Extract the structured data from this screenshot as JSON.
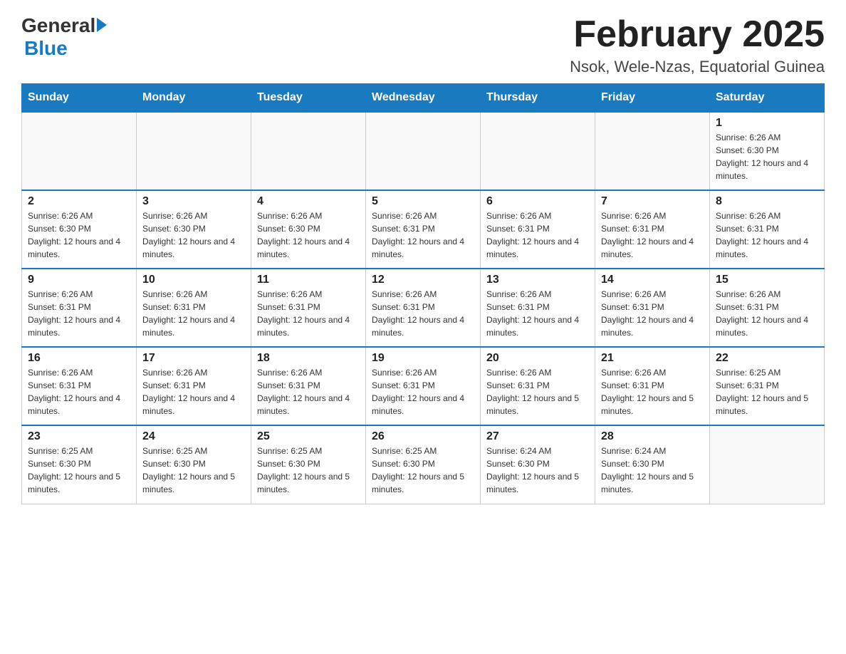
{
  "header": {
    "logo": {
      "general": "General",
      "arrow": "▶",
      "blue": "Blue"
    },
    "title": "February 2025",
    "location": "Nsok, Wele-Nzas, Equatorial Guinea"
  },
  "weekdays": [
    "Sunday",
    "Monday",
    "Tuesday",
    "Wednesday",
    "Thursday",
    "Friday",
    "Saturday"
  ],
  "weeks": [
    [
      {
        "day": "",
        "info": ""
      },
      {
        "day": "",
        "info": ""
      },
      {
        "day": "",
        "info": ""
      },
      {
        "day": "",
        "info": ""
      },
      {
        "day": "",
        "info": ""
      },
      {
        "day": "",
        "info": ""
      },
      {
        "day": "1",
        "info": "Sunrise: 6:26 AM\nSunset: 6:30 PM\nDaylight: 12 hours and 4 minutes."
      }
    ],
    [
      {
        "day": "2",
        "info": "Sunrise: 6:26 AM\nSunset: 6:30 PM\nDaylight: 12 hours and 4 minutes."
      },
      {
        "day": "3",
        "info": "Sunrise: 6:26 AM\nSunset: 6:30 PM\nDaylight: 12 hours and 4 minutes."
      },
      {
        "day": "4",
        "info": "Sunrise: 6:26 AM\nSunset: 6:30 PM\nDaylight: 12 hours and 4 minutes."
      },
      {
        "day": "5",
        "info": "Sunrise: 6:26 AM\nSunset: 6:31 PM\nDaylight: 12 hours and 4 minutes."
      },
      {
        "day": "6",
        "info": "Sunrise: 6:26 AM\nSunset: 6:31 PM\nDaylight: 12 hours and 4 minutes."
      },
      {
        "day": "7",
        "info": "Sunrise: 6:26 AM\nSunset: 6:31 PM\nDaylight: 12 hours and 4 minutes."
      },
      {
        "day": "8",
        "info": "Sunrise: 6:26 AM\nSunset: 6:31 PM\nDaylight: 12 hours and 4 minutes."
      }
    ],
    [
      {
        "day": "9",
        "info": "Sunrise: 6:26 AM\nSunset: 6:31 PM\nDaylight: 12 hours and 4 minutes."
      },
      {
        "day": "10",
        "info": "Sunrise: 6:26 AM\nSunset: 6:31 PM\nDaylight: 12 hours and 4 minutes."
      },
      {
        "day": "11",
        "info": "Sunrise: 6:26 AM\nSunset: 6:31 PM\nDaylight: 12 hours and 4 minutes."
      },
      {
        "day": "12",
        "info": "Sunrise: 6:26 AM\nSunset: 6:31 PM\nDaylight: 12 hours and 4 minutes."
      },
      {
        "day": "13",
        "info": "Sunrise: 6:26 AM\nSunset: 6:31 PM\nDaylight: 12 hours and 4 minutes."
      },
      {
        "day": "14",
        "info": "Sunrise: 6:26 AM\nSunset: 6:31 PM\nDaylight: 12 hours and 4 minutes."
      },
      {
        "day": "15",
        "info": "Sunrise: 6:26 AM\nSunset: 6:31 PM\nDaylight: 12 hours and 4 minutes."
      }
    ],
    [
      {
        "day": "16",
        "info": "Sunrise: 6:26 AM\nSunset: 6:31 PM\nDaylight: 12 hours and 4 minutes."
      },
      {
        "day": "17",
        "info": "Sunrise: 6:26 AM\nSunset: 6:31 PM\nDaylight: 12 hours and 4 minutes."
      },
      {
        "day": "18",
        "info": "Sunrise: 6:26 AM\nSunset: 6:31 PM\nDaylight: 12 hours and 4 minutes."
      },
      {
        "day": "19",
        "info": "Sunrise: 6:26 AM\nSunset: 6:31 PM\nDaylight: 12 hours and 4 minutes."
      },
      {
        "day": "20",
        "info": "Sunrise: 6:26 AM\nSunset: 6:31 PM\nDaylight: 12 hours and 5 minutes."
      },
      {
        "day": "21",
        "info": "Sunrise: 6:26 AM\nSunset: 6:31 PM\nDaylight: 12 hours and 5 minutes."
      },
      {
        "day": "22",
        "info": "Sunrise: 6:25 AM\nSunset: 6:31 PM\nDaylight: 12 hours and 5 minutes."
      }
    ],
    [
      {
        "day": "23",
        "info": "Sunrise: 6:25 AM\nSunset: 6:30 PM\nDaylight: 12 hours and 5 minutes."
      },
      {
        "day": "24",
        "info": "Sunrise: 6:25 AM\nSunset: 6:30 PM\nDaylight: 12 hours and 5 minutes."
      },
      {
        "day": "25",
        "info": "Sunrise: 6:25 AM\nSunset: 6:30 PM\nDaylight: 12 hours and 5 minutes."
      },
      {
        "day": "26",
        "info": "Sunrise: 6:25 AM\nSunset: 6:30 PM\nDaylight: 12 hours and 5 minutes."
      },
      {
        "day": "27",
        "info": "Sunrise: 6:24 AM\nSunset: 6:30 PM\nDaylight: 12 hours and 5 minutes."
      },
      {
        "day": "28",
        "info": "Sunrise: 6:24 AM\nSunset: 6:30 PM\nDaylight: 12 hours and 5 minutes."
      },
      {
        "day": "",
        "info": ""
      }
    ]
  ]
}
